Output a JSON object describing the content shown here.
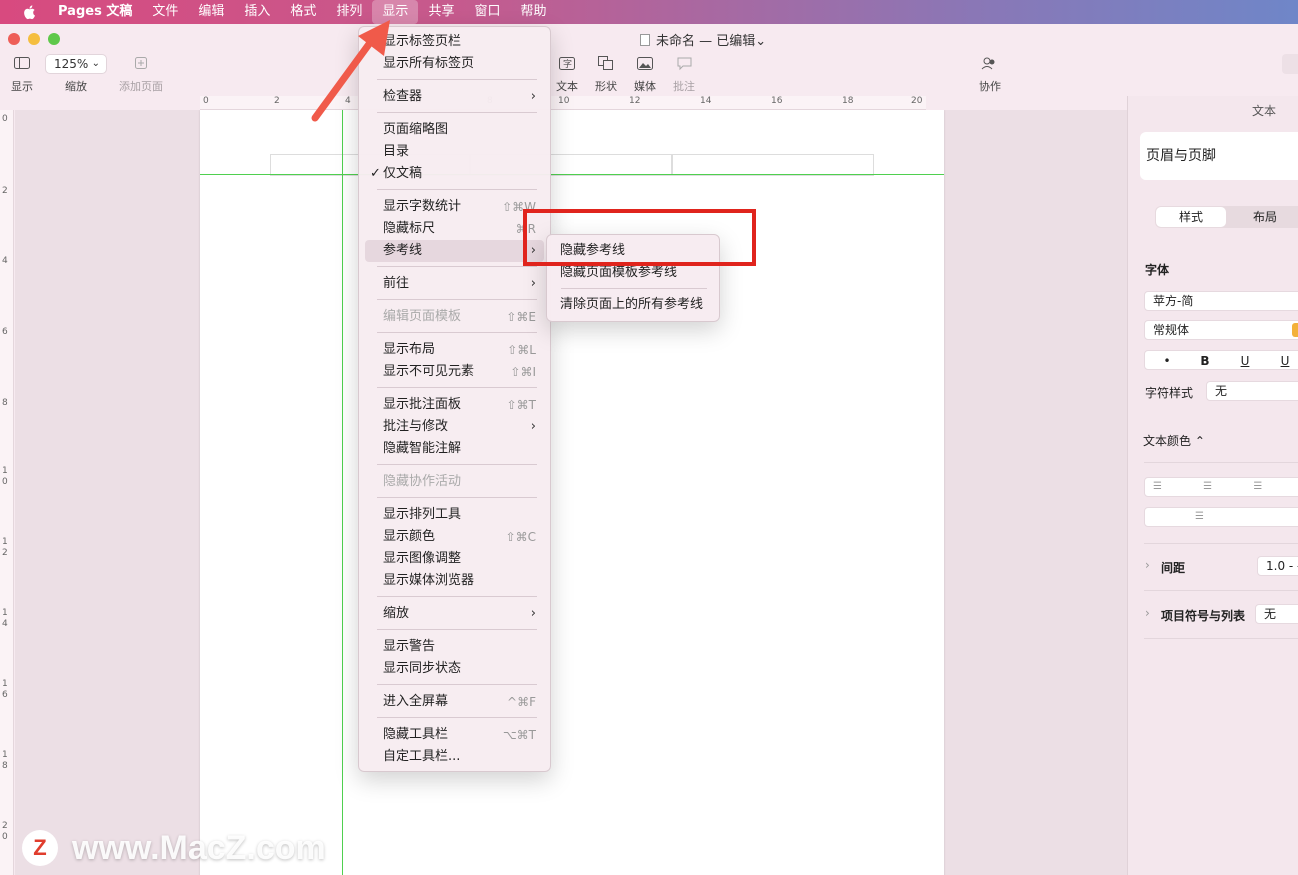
{
  "menubar": {
    "app_name": "Pages 文稿",
    "items": [
      "文件",
      "编辑",
      "插入",
      "格式",
      "排列",
      "显示",
      "共享",
      "窗口",
      "帮助"
    ]
  },
  "window": {
    "title": "未命名 — 已编辑",
    "title_chevron": "⌄"
  },
  "toolbar": {
    "view_label": "显示",
    "zoom_value": "125%",
    "zoom_label": "缩放",
    "add_page_label": "添加页面",
    "text_label": "文本",
    "shape_label": "形状",
    "media_label": "媒体",
    "comment_label": "批注",
    "collaborate_label": "协作"
  },
  "ruler": {
    "h_labels": [
      "0",
      "2",
      "4",
      "6",
      "8",
      "10",
      "12",
      "14",
      "16",
      "18",
      "20"
    ],
    "v_labels": [
      "0",
      "2",
      "4",
      "6",
      "8",
      "10",
      "12",
      "14",
      "16",
      "18",
      "20"
    ]
  },
  "view_menu": {
    "items": [
      {
        "label": "显示标签页栏"
      },
      {
        "label": "显示所有标签页"
      },
      {
        "label": "检查器",
        "submenu": true
      },
      {
        "label": "页面缩略图"
      },
      {
        "label": "目录"
      },
      {
        "label": "仅文稿",
        "checked": true
      },
      {
        "label": "显示字数统计",
        "shortcut": "⇧⌘W"
      },
      {
        "label": "隐藏标尺",
        "shortcut": "⌘R"
      },
      {
        "label": "参考线",
        "submenu": true,
        "highlighted": true
      },
      {
        "label": "前往",
        "submenu": true
      },
      {
        "label": "编辑页面模板",
        "shortcut": "⇧⌘E",
        "disabled": true
      },
      {
        "label": "显示布局",
        "shortcut": "⇧⌘L"
      },
      {
        "label": "显示不可见元素",
        "shortcut": "⇧⌘I"
      },
      {
        "label": "显示批注面板",
        "shortcut": "⇧⌘T"
      },
      {
        "label": "批注与修改",
        "submenu": true
      },
      {
        "label": "隐藏智能注解"
      },
      {
        "label": "隐藏协作活动",
        "disabled": true
      },
      {
        "label": "显示排列工具"
      },
      {
        "label": "显示颜色",
        "shortcut": "⇧⌘C"
      },
      {
        "label": "显示图像调整"
      },
      {
        "label": "显示媒体浏览器"
      },
      {
        "label": "缩放",
        "submenu": true
      },
      {
        "label": "显示警告"
      },
      {
        "label": "显示同步状态"
      },
      {
        "label": "进入全屏幕",
        "shortcut": "^⌘F"
      },
      {
        "label": "隐藏工具栏",
        "shortcut": "⌥⌘T"
      },
      {
        "label": "自定工具栏..."
      }
    ],
    "submenu_arrow": "›",
    "check_mark": "✓"
  },
  "guides_submenu": {
    "items": [
      "隐藏参考线",
      "隐藏页面模板参考线",
      "清除页面上的所有参考线"
    ]
  },
  "inspector": {
    "tab": "文本",
    "style_name": "页眉与页脚",
    "segment_style": "样式",
    "segment_layout": "布局",
    "font_heading": "字体",
    "font_family": "苹方-简",
    "font_weight": "常规体",
    "format_buttons": [
      "•",
      "B",
      "U",
      "U"
    ],
    "char_style_label": "字符样式",
    "char_style_value": "无",
    "text_color_label": "文本颜色 ⌃",
    "spacing_label": "间距",
    "spacing_value": "1.0 - -",
    "bullets_label": "项目符号与列表",
    "bullets_value": "无",
    "disclosure": "›"
  },
  "annotation": {
    "highlight_color": "#e0241d",
    "arrow_color": "#f05a4a"
  },
  "watermark": {
    "logo_letter": "Z",
    "text": "www.MacZ.com"
  }
}
